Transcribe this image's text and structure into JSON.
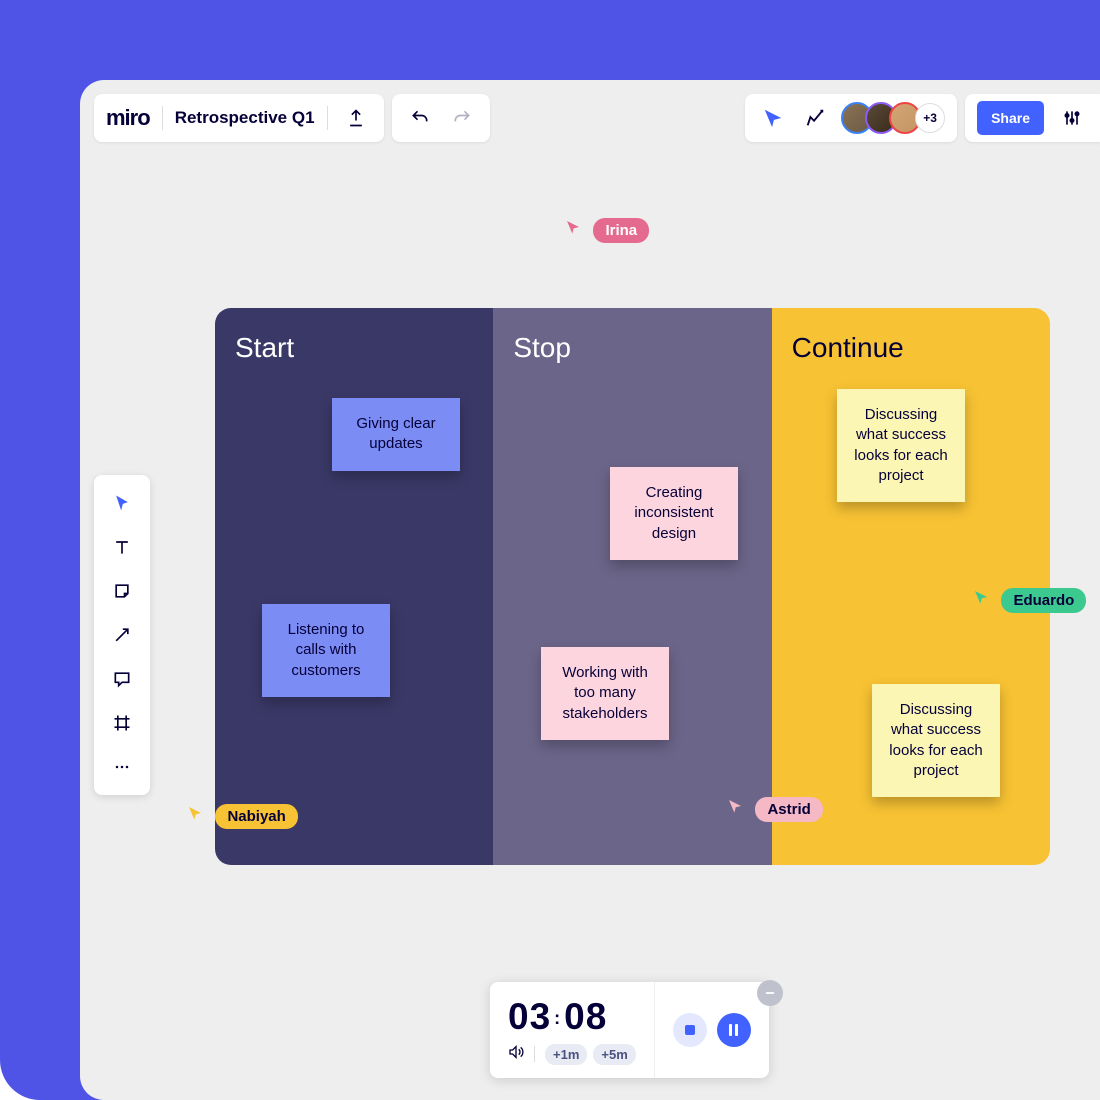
{
  "header": {
    "logo": "miro",
    "board_title": "Retrospective Q1",
    "avatar_overflow": "+3",
    "share_label": "Share"
  },
  "columns": {
    "start": {
      "title": "Start"
    },
    "stop": {
      "title": "Stop"
    },
    "continue": {
      "title": "Continue"
    }
  },
  "stickies": {
    "start1": "Giving clear updates",
    "start2": "Listening to calls with customers",
    "stop1": "Creating inconsistent design",
    "stop2": "Working with too many stakeholders",
    "cont1": "Discussing what success looks for each project",
    "cont2": "Discussing what success looks for each project"
  },
  "cursors": {
    "irina": "Irina",
    "nabiyah": "Nabiyah",
    "astrid": "Astrid",
    "eduardo": "Eduardo"
  },
  "timer": {
    "minutes": "03",
    "seconds": "08",
    "add1": "+1m",
    "add5": "+5m"
  }
}
